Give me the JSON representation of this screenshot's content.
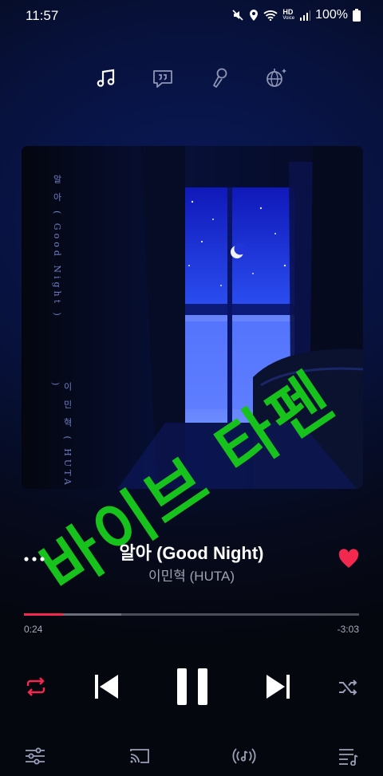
{
  "status_bar": {
    "time": "11:57",
    "network_label": "HD",
    "network_sublabel": "Voice",
    "battery": "100%"
  },
  "mode_tabs": [
    {
      "icon": "music-note-icon"
    },
    {
      "icon": "lyrics-quote-icon"
    },
    {
      "icon": "microphone-icon"
    },
    {
      "icon": "disco-ball-icon"
    }
  ],
  "album_art": {
    "vertical_title": "알 아 ( Good Night )",
    "vertical_artist": "이 민 혁 ( HUTA )"
  },
  "watermark": "바이브 타펜",
  "track": {
    "title": "알아 (Good Night)",
    "artist": "이민혁 (HUTA)",
    "liked": true
  },
  "progress": {
    "elapsed": "0:24",
    "remaining": "-3:03",
    "played_fraction": 0.116,
    "buffered_fraction": 0.29
  },
  "colors": {
    "accent": "#f2284f",
    "watermark": "#16c21b",
    "background": "#07113b"
  }
}
